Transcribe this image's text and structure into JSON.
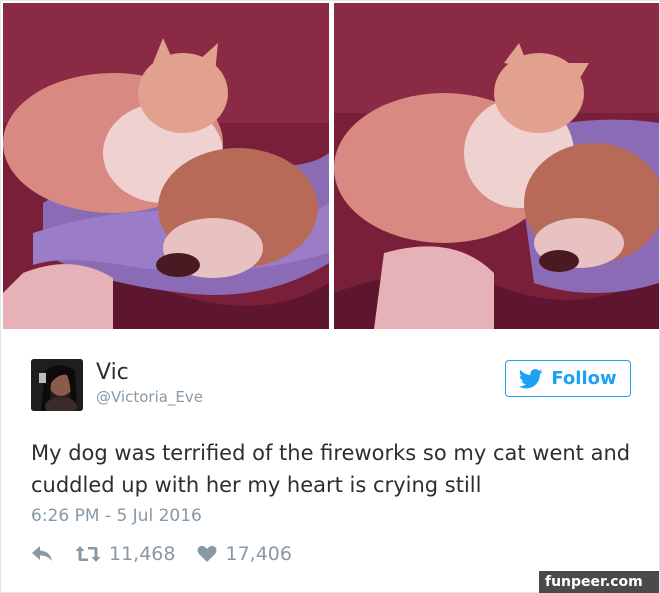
{
  "tweet": {
    "display_name": "Vic",
    "screen_name": "@Victoria_Eve",
    "follow_label": "Follow",
    "text": "My dog was terrified of the fireworks so my cat went and cuddled up with her my heart is crying still",
    "timestamp": "6:26 PM - 5 Jul 2016",
    "retweet_count": "11,468",
    "like_count": "17,406"
  },
  "photos": [
    {
      "subject": "cat resting head on sleeping dog on purple blanket"
    },
    {
      "subject": "cat cuddled against sleeping dog, closer view"
    }
  ],
  "icons": {
    "follow": "twitter-bird-icon",
    "reply": "reply-icon",
    "retweet": "retweet-icon",
    "like": "heart-icon"
  },
  "colors": {
    "accent": "#1da1f2",
    "text": "#292f33",
    "muted": "#8899a6",
    "border": "#e1e8ed"
  },
  "watermark": {
    "text": "funpeer.com"
  }
}
